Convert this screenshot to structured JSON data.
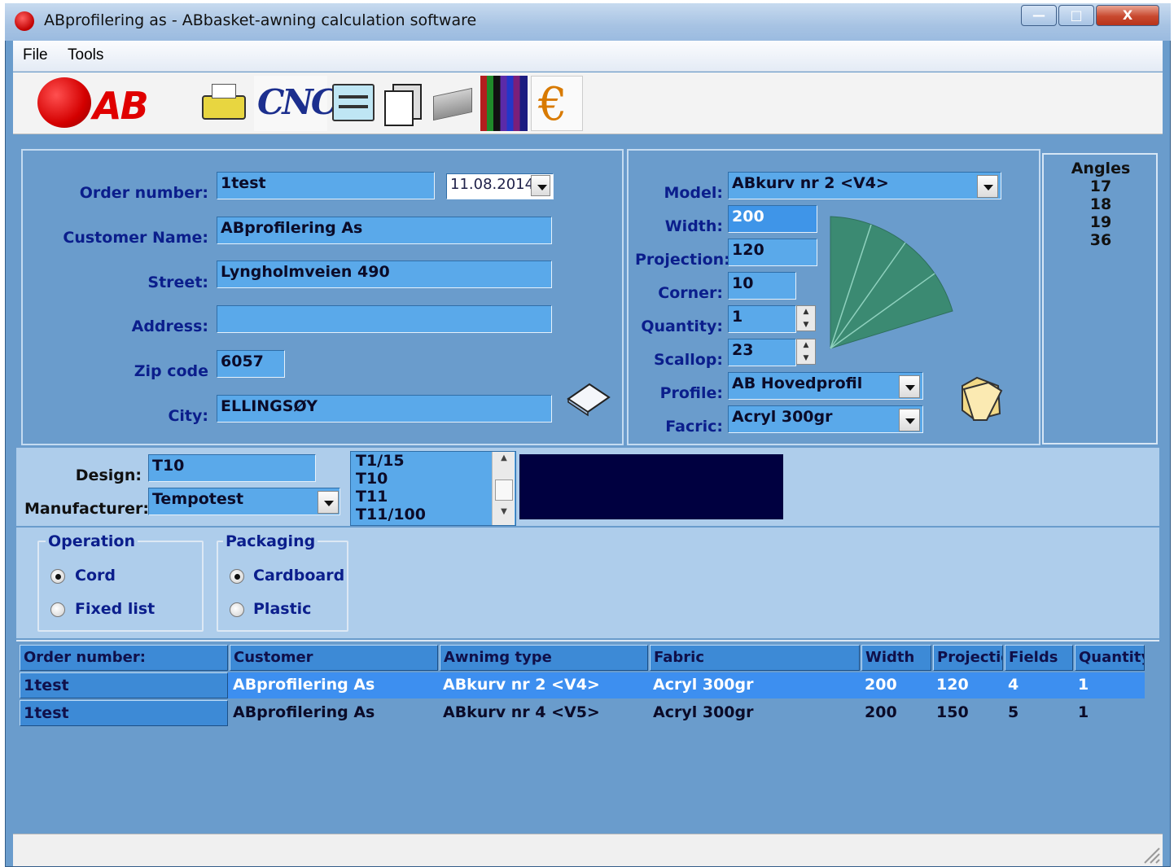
{
  "window": {
    "title": "ABprofilering as - ABbasket-awning calculation software",
    "minimize_glyph": "—",
    "maximize_glyph": "□",
    "close_glyph": "X"
  },
  "menu": {
    "items": [
      "File",
      "Tools"
    ]
  },
  "toolbar": {
    "logo_text": "AB",
    "cnc_text": "CNC",
    "euro_text": "€",
    "icons": [
      "ab-logo-icon",
      "typewriter-icon",
      "cnc-icon",
      "settings-form-icon",
      "documents-icon",
      "printer-icon",
      "fabric-colors-icon",
      "euro-icon"
    ]
  },
  "customer": {
    "order_number_label": "Order number:",
    "order_number": "1test",
    "date": "11.08.2014",
    "customer_name_label": "Customer Name:",
    "customer_name": "ABprofilering As",
    "street_label": "Street:",
    "street": "Lyngholmveien 490",
    "address_label": "Address:",
    "address": "",
    "zip_label": "Zip code",
    "zip": "6057",
    "city_label": "City:",
    "city": "ELLINGSØY"
  },
  "awning": {
    "model_label": "Model:",
    "model": "ABkurv nr 2 <V4>",
    "width_label": "Width:",
    "width": "200",
    "projection_label": "Projection:",
    "projection": "120",
    "corner_label": "Corner:",
    "corner": "10",
    "quantity_label": "Quantity:",
    "quantity": "1",
    "scallop_label": "Scallop:",
    "scallop": "23",
    "profile_label": "Profile:",
    "profile": "AB Hovedprofil",
    "fabric_label": "Facric:",
    "fabric": "Acryl 300gr"
  },
  "angles": {
    "title": "Angles",
    "values": [
      "17",
      "18",
      "19",
      "36"
    ]
  },
  "design": {
    "design_label": "Design:",
    "design": "T10",
    "manufacturer_label": "Manufacturer:",
    "manufacturer": "Tempotest",
    "list": [
      "T1/15",
      "T10",
      "T11",
      "T11/100"
    ],
    "preview_color": "#000040"
  },
  "operation": {
    "title": "Operation",
    "options": [
      "Cord",
      "Fixed list"
    ],
    "selected": "Cord"
  },
  "packaging": {
    "title": "Packaging",
    "options": [
      "Cardboard",
      "Plastic"
    ],
    "selected": "Cardboard"
  },
  "table": {
    "columns": [
      "Order number:",
      "Customer",
      "Awnimg type",
      "Fabric",
      "Width",
      "Projectio",
      "Fields",
      "Quantity"
    ],
    "rows": [
      [
        "1test",
        "ABprofilering As",
        "ABkurv nr 2 <V4>",
        "Acryl 300gr",
        "200",
        "120",
        "4",
        "1"
      ],
      [
        "1test",
        "ABprofilering As",
        "ABkurv nr 4 <V5>",
        "Acryl 300gr",
        "200",
        "150",
        "5",
        "1"
      ]
    ],
    "selected_row": 0
  },
  "colors": {
    "panel_blue": "#6a9ccc",
    "light_panel": "#aecdeb",
    "field_blue": "#5aa9ea",
    "label_navy": "#0b1e8c",
    "selected_row": "#3d8ff0",
    "fan_green": "#3b8a72"
  }
}
